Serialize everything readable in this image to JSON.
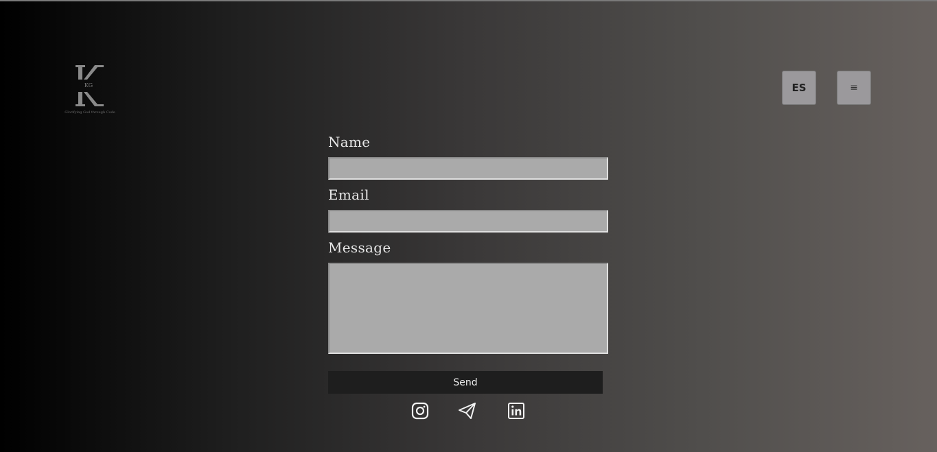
{
  "header": {
    "logo": {
      "letters": "KG",
      "tagline": "Glorifying God through Code"
    },
    "language_button": "ES",
    "menu_button": "≡"
  },
  "form": {
    "name_label": "Name",
    "name_value": "",
    "email_label": "Email",
    "email_value": "",
    "message_label": "Message",
    "message_value": "",
    "send_label": "Send"
  },
  "social": [
    {
      "icon": "instagram-icon"
    },
    {
      "icon": "telegram-icon"
    },
    {
      "icon": "linkedin-icon"
    }
  ],
  "colors": {
    "input_background": "#aaaaaa",
    "button_background": "#1e1e1e",
    "control_background": "#9b999c"
  }
}
